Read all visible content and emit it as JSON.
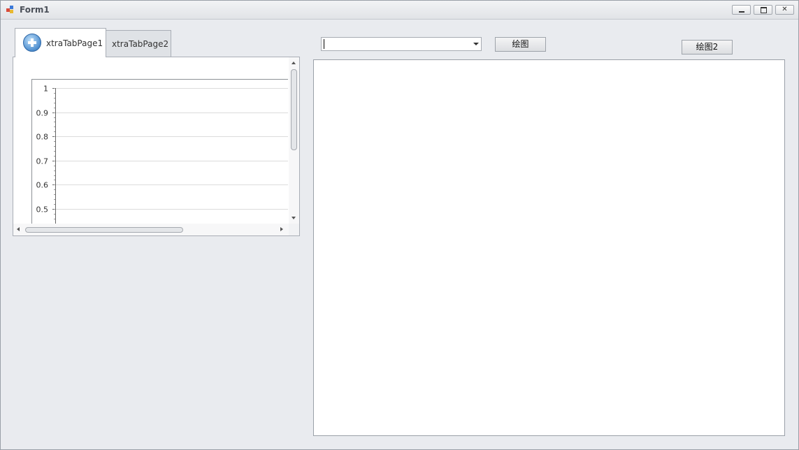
{
  "window": {
    "title": "Form1",
    "minimize_icon": "minimize-icon",
    "maximize_icon": "maximize-icon",
    "close_glyph": "✕"
  },
  "tabs": [
    {
      "label": "xtraTabPage1",
      "icon": "add-circle-icon",
      "active": true
    },
    {
      "label": "xtraTabPage2",
      "active": false
    }
  ],
  "chart_data": {
    "type": "line",
    "series": [],
    "y_tick_labels": [
      "1",
      "0.9",
      "0.8",
      "0.7",
      "0.6",
      "0.5"
    ],
    "y_ticks": [
      1,
      0.9,
      0.8,
      0.7,
      0.6,
      0.5
    ],
    "ylim_visible": [
      0.5,
      1
    ],
    "grid": true
  },
  "combo": {
    "value": ""
  },
  "buttons": {
    "draw": "绘图",
    "draw2": "绘图2"
  },
  "colors": {
    "window_bg": "#e9ebef",
    "panel_bg": "#ffffff",
    "border": "#9aa0a8"
  }
}
